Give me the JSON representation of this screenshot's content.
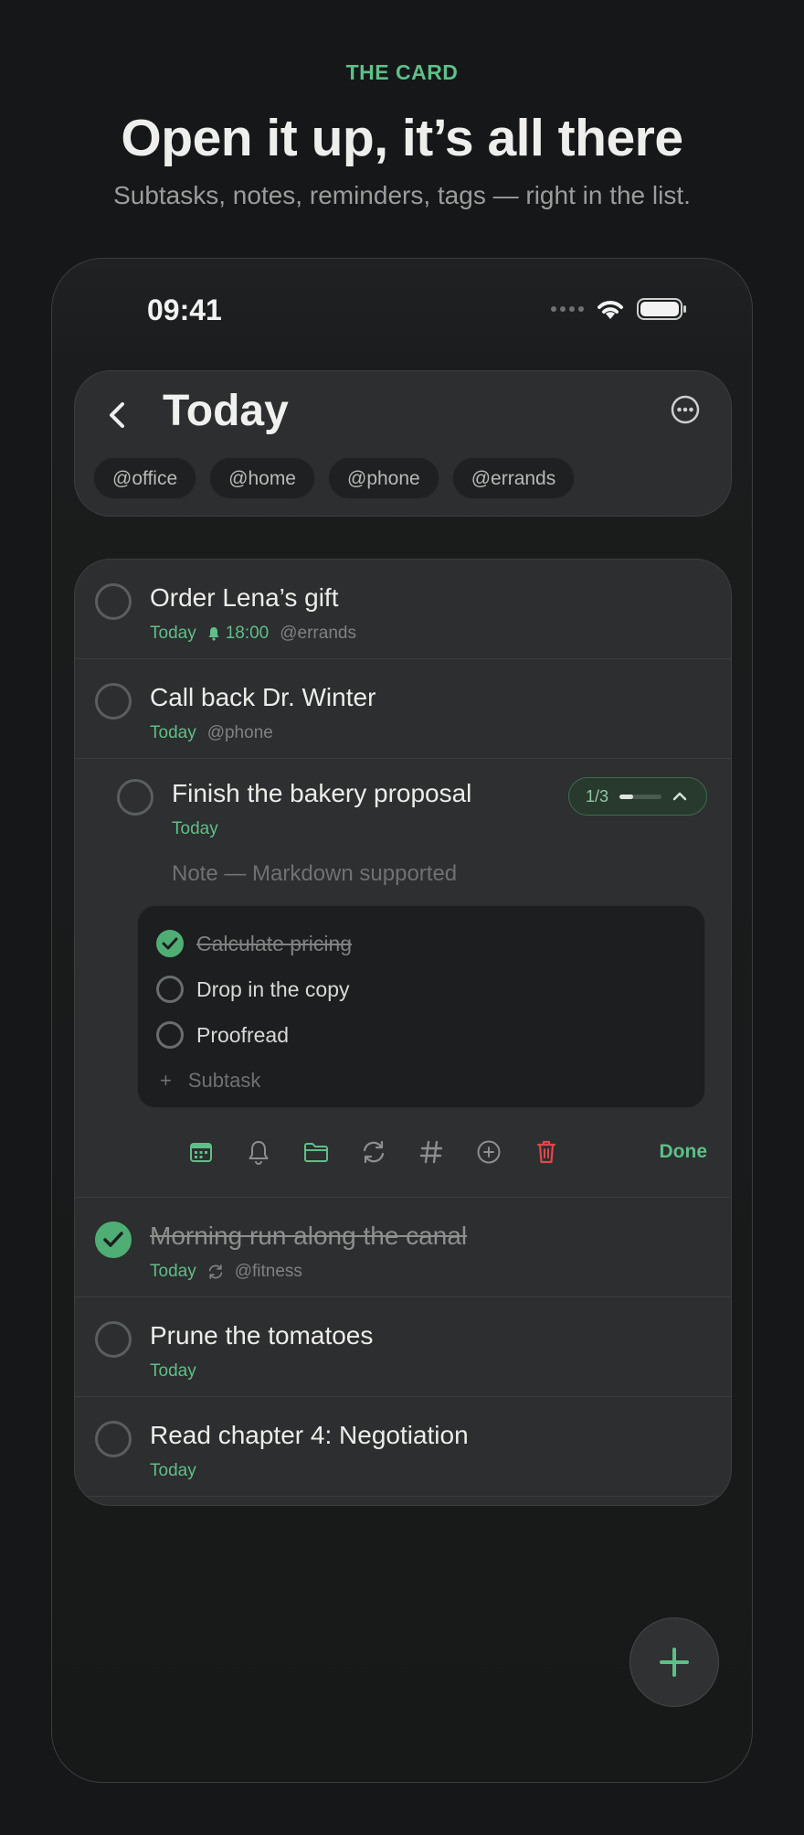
{
  "marketing": {
    "eyebrow": "THE CARD",
    "headline": "Open it up, it’s all there",
    "subline": "Subtasks, notes, reminders, tags — right in the list."
  },
  "statusbar": {
    "time": "09:41",
    "icons": [
      "signal-dots-icon",
      "wifi-icon",
      "battery-icon"
    ]
  },
  "header": {
    "title": "Today",
    "tags": [
      "@office",
      "@home",
      "@phone",
      "@errands"
    ]
  },
  "tasks": [
    {
      "title": "Order Lena’s gift",
      "date": "Today",
      "reminder": "18:00",
      "context": "@errands",
      "completed": false
    },
    {
      "title": "Call back Dr. Winter",
      "date": "Today",
      "context": "@phone",
      "completed": false
    },
    {
      "title": "Finish the bakery proposal",
      "date": "Today",
      "completed": false,
      "expanded": true,
      "progress_label": "1/3",
      "progress_fraction": 0.33,
      "note_placeholder": "Note — Markdown supported",
      "subtasks": [
        {
          "label": "Calculate pricing",
          "completed": true
        },
        {
          "label": "Drop in the copy",
          "completed": false
        },
        {
          "label": "Proofread",
          "completed": false
        }
      ],
      "add_subtask_label": "Subtask",
      "toolbar": [
        "calendar-icon",
        "bell-icon",
        "folder-icon",
        "repeat-icon",
        "hashtag-icon",
        "add-circle-icon",
        "trash-icon"
      ],
      "done_label": "Done"
    },
    {
      "title": "Morning run along the canal",
      "date": "Today",
      "repeats": true,
      "context": "@fitness",
      "completed": true
    },
    {
      "title": "Prune the tomatoes",
      "date": "Today",
      "completed": false
    },
    {
      "title": "Read chapter 4: Negotiation",
      "date": "Today",
      "completed": false
    }
  ],
  "colors": {
    "accent": "#5fbf88",
    "danger": "#e0474c",
    "background": "#151718",
    "card": "#2c2e2f"
  }
}
